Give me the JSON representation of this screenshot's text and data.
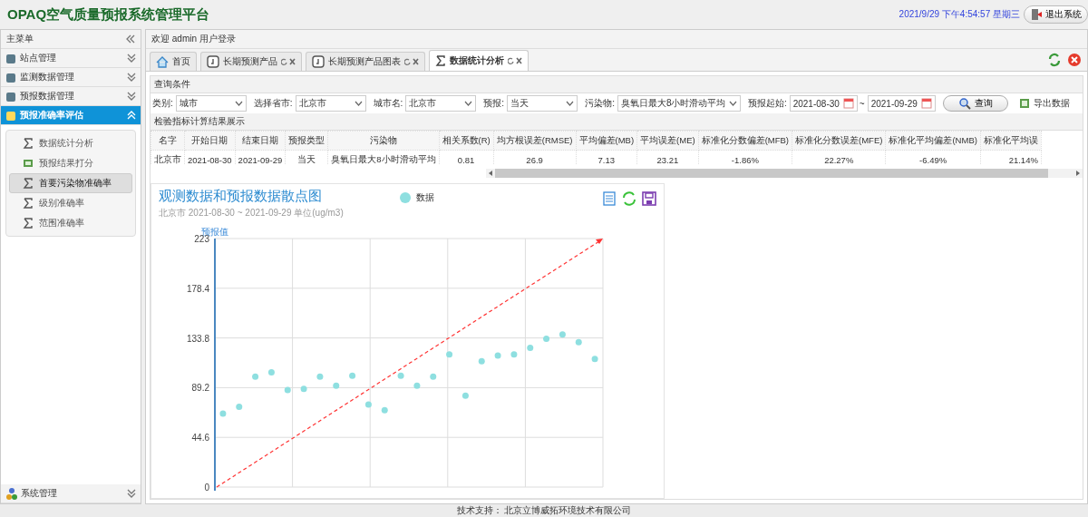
{
  "header": {
    "title": "OPAQ空气质量预报系统管理平台",
    "datetime": "2021/9/29 下午4:54:57 星期三",
    "logout": "退出系统"
  },
  "sidebar": {
    "title": "主菜单",
    "sections": [
      {
        "label": "站点管理",
        "expanded": false
      },
      {
        "label": "监测数据管理",
        "expanded": false
      },
      {
        "label": "预报数据管理",
        "expanded": false
      },
      {
        "label": "预报准确率评估",
        "expanded": true,
        "items": [
          {
            "label": "数据统计分析",
            "selected": false,
            "kind": "sigma"
          },
          {
            "label": "预报结果打分",
            "selected": false,
            "kind": "sheet"
          },
          {
            "label": "首要污染物准确率",
            "selected": true,
            "kind": "sigma"
          },
          {
            "label": "级别准确率",
            "selected": false,
            "kind": "sigma"
          },
          {
            "label": "范围准确率",
            "selected": false,
            "kind": "sigma"
          }
        ]
      }
    ],
    "footer_section": {
      "label": "系统管理",
      "expanded": false
    }
  },
  "welcome": "欢迎 admin 用户登录",
  "tabs": [
    {
      "label": "首页",
      "selected": false,
      "kind": "home"
    },
    {
      "label": "长期预测产品",
      "selected": false,
      "kind": "page"
    },
    {
      "label": "长期预测产品图表",
      "selected": false,
      "kind": "page"
    },
    {
      "label": "数据统计分析",
      "selected": true,
      "kind": "sigma"
    }
  ],
  "query": {
    "title": "查询条件",
    "fields": [
      {
        "label": "类别:",
        "value": "城市",
        "kind": "select"
      },
      {
        "label": "选择省市:",
        "value": "北京市",
        "kind": "select"
      },
      {
        "label": "城市名:",
        "value": "北京市",
        "kind": "select"
      },
      {
        "label": "预报:",
        "value": "当天",
        "kind": "select"
      },
      {
        "label": "污染物:",
        "value": "臭氧日最大8小时滑动平均",
        "kind": "select"
      },
      {
        "label": "预报起始:",
        "value": "2021-08-30",
        "kind": "date"
      },
      {
        "value": "2021-09-29",
        "kind": "date"
      }
    ],
    "range_separator": "~",
    "search_button": "查询",
    "export": "导出数据"
  },
  "results": {
    "title": "检验指标计算结果展示",
    "columns": [
      "名字",
      "开始日期",
      "结束日期",
      "预报类型",
      "污染物",
      "相关系数(R)",
      "均方根误差(RMSE)",
      "平均偏差(MB)",
      "平均误差(ME)",
      "标准化分数偏差(MFB)",
      "标准化分数误差(MFE)",
      "标准化平均偏差(NMB)",
      "标准化平均误"
    ],
    "rows": [
      [
        "北京市",
        "2021-08-30",
        "2021-09-29",
        "当天",
        "臭氧日最大8小时滑动平均",
        "0.81",
        "26.9",
        "7.13",
        "23.21",
        "-1.86%",
        "22.27%",
        "-6.49%",
        "21.14%"
      ]
    ]
  },
  "chart": {
    "subtitle": "北京市 2021-08-30 ~ 2021-09-29 单位(ug/m3)",
    "chart_data": {
      "type": "scatter",
      "title": "观测数据和预报数据散点图",
      "ylabel": "预报值",
      "categories": [
        null,
        null,
        null,
        null,
        null,
        null,
        null,
        null,
        null,
        null,
        null,
        null,
        null,
        null,
        null,
        null,
        null,
        null,
        null,
        null,
        null,
        null,
        null,
        null
      ],
      "ylim": [
        0,
        223
      ],
      "yticks": [
        0,
        44.6,
        89.2,
        133.8,
        178.4,
        223
      ],
      "series": [
        {
          "name": "数据",
          "color": "#8edfe0",
          "values": [
            66,
            72,
            99,
            103,
            87,
            88,
            99,
            91,
            100,
            74,
            69,
            100,
            91,
            99,
            119,
            82,
            113,
            118,
            119,
            125,
            133,
            137,
            130,
            115
          ]
        }
      ],
      "grid": true
    }
  },
  "footer": "技术支持： 北京立博威拓环境技术有限公司"
}
